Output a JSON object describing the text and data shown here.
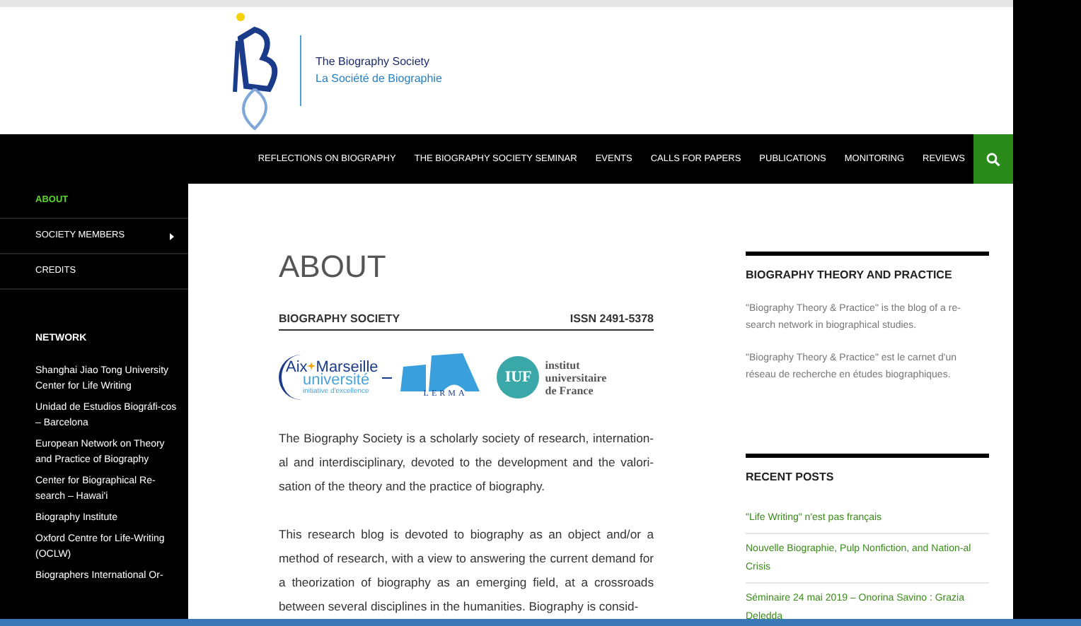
{
  "site": {
    "title": "The Biography Society",
    "subtitle": "La Société de Biographie"
  },
  "nav": [
    {
      "label": "REFLECTIONS ON BIOGRAPHY"
    },
    {
      "label": "THE BIOGRAPHY SOCIETY SEMINAR"
    },
    {
      "label": "EVENTS"
    },
    {
      "label": "CALLS FOR PAPERS"
    },
    {
      "label": "PUBLICATIONS"
    },
    {
      "label": "MONITORING"
    },
    {
      "label": "REVIEWS"
    }
  ],
  "sidebar": {
    "items": [
      {
        "label": "ABOUT",
        "selected": true,
        "has_submenu": false
      },
      {
        "label": "SOCIETY MEMBERS",
        "selected": false,
        "has_submenu": true
      },
      {
        "label": "CREDITS",
        "selected": false,
        "has_submenu": false
      }
    ],
    "network": {
      "title": "NETWORK",
      "links": [
        "Shanghai Jiao Tong University Center for Life Writing",
        "Unidad de Estudios Biográfi-cos – Barcelona",
        "European Network on Theory and Practice of Biography",
        "Center for Biographical Re-search – Hawai'i",
        "Biography Institute",
        "Oxford Centre for Life-Writing (OCLW)",
        "Biographers International Or-"
      ]
    }
  },
  "article": {
    "title": "ABOUT",
    "subheading": "BIOGRAPHY SOCIETY",
    "issn": "ISSN 2491-5378",
    "logos": {
      "amu": [
        "Aix",
        "Marseille",
        "université",
        "initiative d'excellence"
      ],
      "lerma": "LERMA",
      "iuf": "IUF",
      "iuf_name": [
        "institut",
        "universitaire",
        "de France"
      ]
    },
    "paragraphs": [
      "The Biography Society is a scholarly society of research, internation-al and interdisciplinary, devoted to the development and the valori-sation of the theory and the practice of biography.",
      "This research blog is devoted to biography as an object and/or a method of research, with a view to answering the current demand for a theorization of biography as an emerging field, at a crossroads between several disciplines in the humanities. Biography is consid-"
    ]
  },
  "widgets": [
    {
      "title": "BIOGRAPHY THEORY AND PRACTICE",
      "paragraphs": [
        "\"Biography Theory & Practice\" is the blog of a re-search network in biographical studies.",
        "\"Biography Theory & Practice\" est le carnet d'un réseau de recherche en études biographiques."
      ]
    },
    {
      "title": "RECENT POSTS",
      "posts": [
        "\"Life Writing\" n'est pas français",
        "Nouvelle Biographie, Pulp Nonfiction, and Nation-al Crisis",
        "Séminaire 24 mai 2019 – Onorina Savino : Grazia Deledda"
      ]
    }
  ]
}
